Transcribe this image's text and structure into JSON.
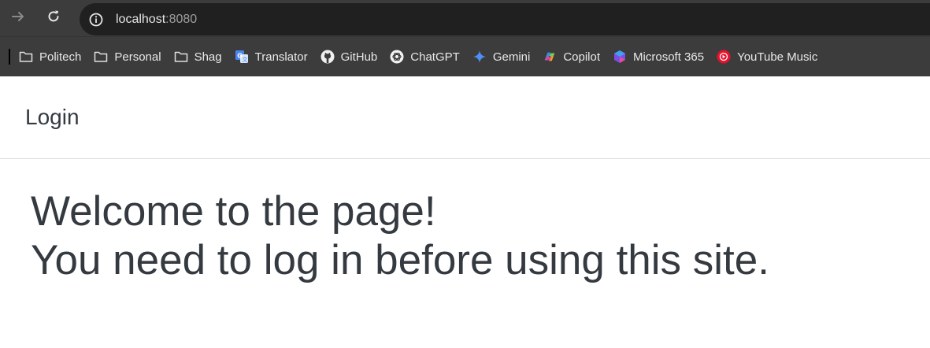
{
  "browser": {
    "address_bar": {
      "host": "localhost",
      "port": ":8080"
    },
    "icons": {
      "forward": "arrow-right-icon",
      "reload": "reload-icon",
      "site_info": "info-circle-icon"
    },
    "bookmarks": [
      {
        "label": "Politech",
        "icon": "folder-icon"
      },
      {
        "label": "Personal",
        "icon": "folder-icon"
      },
      {
        "label": "Shag",
        "icon": "folder-icon"
      },
      {
        "label": "Translator",
        "icon": "google-translate-icon"
      },
      {
        "label": "GitHub",
        "icon": "github-icon"
      },
      {
        "label": "ChatGPT",
        "icon": "chatgpt-icon"
      },
      {
        "label": "Gemini",
        "icon": "gemini-icon"
      },
      {
        "label": "Copilot",
        "icon": "copilot-icon"
      },
      {
        "label": "Microsoft 365",
        "icon": "microsoft-365-icon"
      },
      {
        "label": "YouTube Music",
        "icon": "youtube-music-icon"
      }
    ]
  },
  "page": {
    "navbar": {
      "brand": "Login"
    },
    "hero": {
      "line1": "Welcome to the page!",
      "line2": "You need to log in before using this site."
    }
  },
  "colors": {
    "chrome_bg": "#3c3c3c",
    "omnibox_bg": "#202020",
    "text_dark": "#343a40",
    "gemini_blue": "#4f8ef7",
    "youtube_red": "#e8112d"
  }
}
